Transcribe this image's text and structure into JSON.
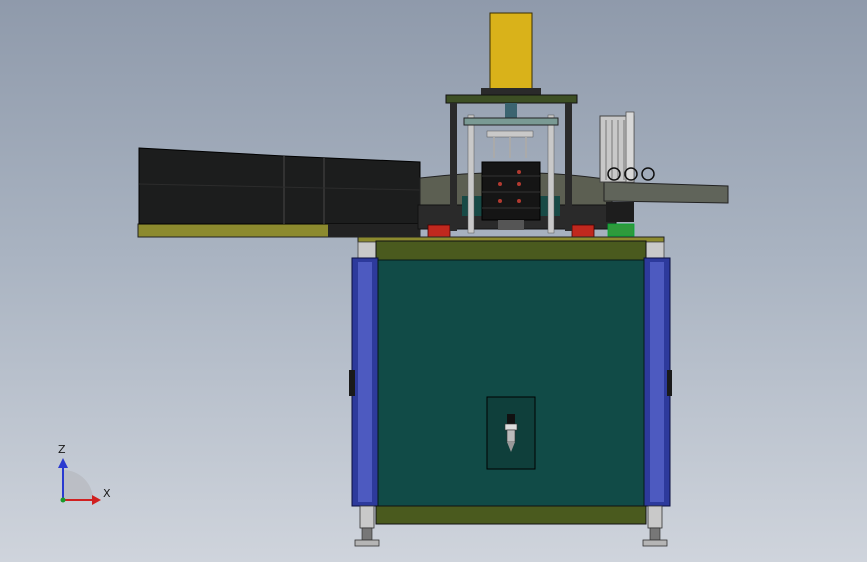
{
  "viewport": {
    "background_top": "#8f9aab",
    "background_bottom": "#cfd4dc"
  },
  "colors": {
    "cabinet_panel": "#114b47",
    "cabinet_rail": "#4a5a1e",
    "side_post": "#2d3a9c",
    "cylinder": "#d9b21a",
    "platform_plate": "#3d4f24",
    "conveyor_body": "#1c1d1d",
    "conveyor_base": "#8c8a2e",
    "turntable": "#5c5f52",
    "indicator_red": "#c0281e",
    "indicator_green": "#2e9a3c"
  },
  "triad": {
    "z_label": "Z",
    "x_label": "X",
    "z_color": "#2a3ad0",
    "x_color": "#d02020",
    "origin_color": "#1a9a2a"
  }
}
